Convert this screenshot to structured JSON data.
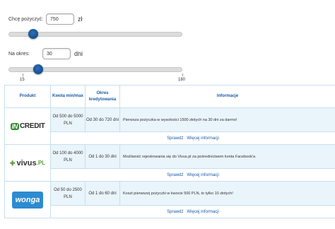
{
  "amount": {
    "label": "Chcę pożyczyć:",
    "value": "750",
    "unit": "zł",
    "slider_level": 0.14
  },
  "period": {
    "label": "Na okres:",
    "value": "30",
    "unit": "dni",
    "slider_level": 0.17,
    "tick_min": "15",
    "tick_max": "180"
  },
  "table": {
    "headers": {
      "product": "Produkt",
      "amount": "Kwota min/max",
      "period": "Okres kredytowania",
      "info": "Informacje"
    },
    "rows": [
      {
        "logo_name": "incredit-logo",
        "logo_in": "IN",
        "logo_text": "CREDIT",
        "amount": "Od 500 do 5000 PLN",
        "period": "Od 30 do 720 dni",
        "info": "Pierwsza pożyczka w wysokości 1500 złotych na 30 dni za darmo!",
        "check": "Sprawdź",
        "more": "Więcej informacji"
      },
      {
        "logo_name": "vivus-logo",
        "logo_text": "vivus",
        "logo_suffix": ".PL",
        "amount": "Od 100 do 4000 PLN",
        "period": "Od 1 do 30 dni",
        "info": "Możliwość rejestrowania się do Vivus.pl za pośrednictwem konta Facebook'a",
        "check": "Sprawdź",
        "more": "Więcej informacji"
      },
      {
        "logo_name": "wonga-logo",
        "logo_text": "wonga",
        "amount": "Od 50 do 2500 PLN",
        "period": "Od 1 do 60 dni",
        "info": "Koszt pierwszej pożyczki w kwocie 500 PLN, to tylko 10 złotych!",
        "check": "Sprawdź",
        "more": "Więcej informacji"
      }
    ]
  },
  "colors": {
    "accent": "#1a5aa6",
    "row_bg": "#eaf4fb",
    "thumb": "#1a4f8f"
  }
}
